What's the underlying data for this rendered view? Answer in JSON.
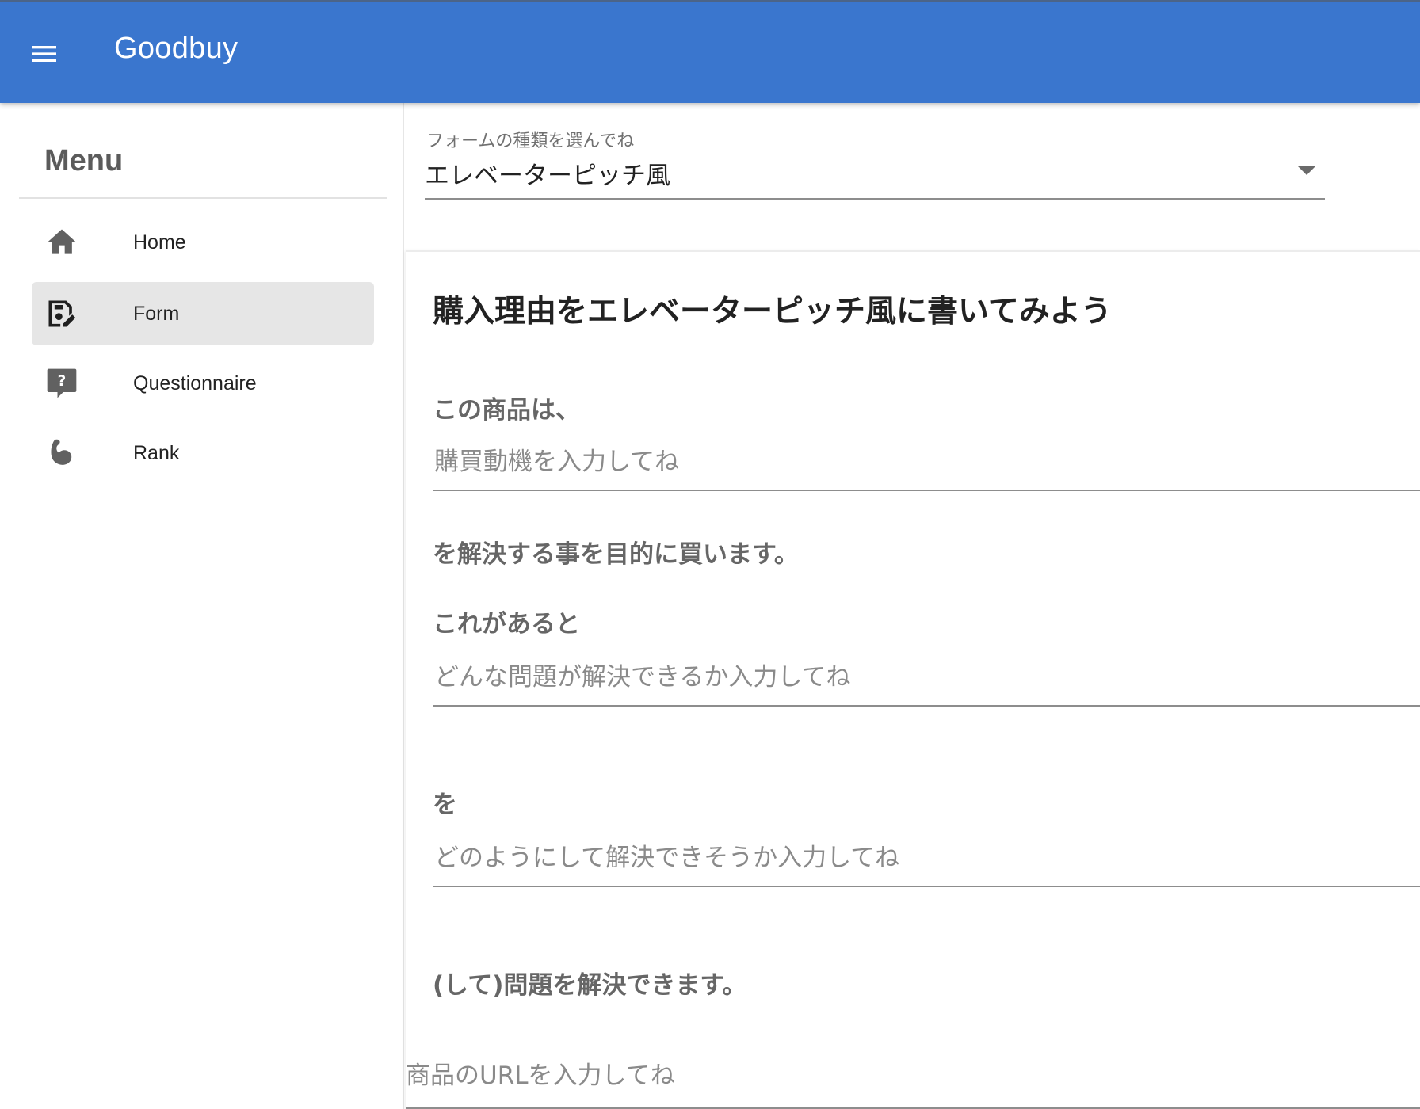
{
  "app_bar": {
    "title": "Goodbuy",
    "menu_icon": "menu-icon",
    "color": "#3a76ce"
  },
  "drawer": {
    "title": "Menu",
    "items": [
      {
        "label": "Home",
        "icon": "home-icon",
        "active": false
      },
      {
        "label": "Form",
        "icon": "edit-note-icon",
        "active": true
      },
      {
        "label": "Questionnaire",
        "icon": "question-bubble-icon",
        "active": false
      },
      {
        "label": "Rank",
        "icon": "flexed-arm-icon",
        "active": false
      }
    ]
  },
  "form_type_select": {
    "label": "フォームの種類を選んでね",
    "value": "エレベーターピッチ風"
  },
  "form": {
    "title": "購入理由をエレベーターピッチ風に書いてみよう",
    "caption_1": "この商品は、",
    "field_1_placeholder": "購買動機を入力してね",
    "caption_2": "を解決する事を目的に買います。",
    "caption_3": "これがあると",
    "field_2_placeholder": "どんな問題が解決できるか入力してね",
    "caption_4": "を",
    "field_3_placeholder": "どのようにして解決できそうか入力してね",
    "caption_5": "(して)問題を解決できます。",
    "url_placeholder": "商品のURLを入力してね"
  }
}
